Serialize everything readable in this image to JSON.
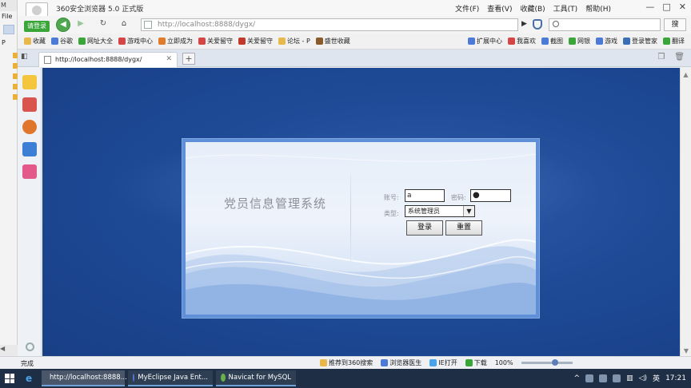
{
  "left_app": {
    "top_label": "M",
    "file_label": "File",
    "tab_label": "P"
  },
  "browser": {
    "title": "360安全浏览器 5.0 正式版",
    "login_badge": "请登录",
    "menu": [
      "文件(F)",
      "查看(V)",
      "收藏(B)",
      "工具(T)",
      "帮助(H)"
    ],
    "window_controls": [
      "—",
      "□",
      "✕"
    ]
  },
  "navbar": {
    "address": "http://localhost:8888/dygx/",
    "search_placeholder": "",
    "search_button": "搜"
  },
  "bookmarks": {
    "left": [
      {
        "label": "收藏",
        "color": "#e8b94a"
      },
      {
        "label": "谷歌",
        "color": "#4b7bd6"
      },
      {
        "label": "网址大全",
        "color": "#3aa63a"
      },
      {
        "label": "游戏中心",
        "color": "#d64545"
      },
      {
        "label": "立即成为",
        "color": "#e07b2a"
      },
      {
        "label": "关爱留守",
        "color": "#d64545"
      },
      {
        "label": "关爱留守",
        "color": "#c0392b"
      },
      {
        "label": "论坛 - P",
        "color": "#e8b94a"
      },
      {
        "label": "盛世收藏",
        "color": "#8b5a2b"
      }
    ],
    "right": [
      {
        "label": "扩展中心",
        "color": "#4b7bd6"
      },
      {
        "label": "我喜欢",
        "color": "#d64545"
      },
      {
        "label": "截图",
        "color": "#4b7bd6"
      },
      {
        "label": "网银",
        "color": "#3aa63a"
      },
      {
        "label": "游戏",
        "color": "#4b7bd6"
      },
      {
        "label": "登录管家",
        "color": "#3a6fb5"
      },
      {
        "label": "翻译",
        "color": "#3aa63a"
      }
    ]
  },
  "tab": {
    "title": "http://localhost:8888/dygx/",
    "close": "✕",
    "new": "+"
  },
  "login": {
    "system_title": "党员信息管理系统",
    "account_label": "账号:",
    "account_value": "a",
    "password_label": "密码:",
    "password_mask": "●",
    "type_label": "类型:",
    "type_selected": "系统管理员",
    "login_button": "登录",
    "reset_button": "重置"
  },
  "statusbar": {
    "status": "完成",
    "items": [
      {
        "label": "推荐到360搜索",
        "color": "#e8b94a"
      },
      {
        "label": "浏览器医生",
        "color": "#4b7bd6"
      },
      {
        "label": "IE打开",
        "color": "#4aa3ea"
      },
      {
        "label": "下载",
        "color": "#3aa63a"
      }
    ],
    "zoom": "100%"
  },
  "taskbar": {
    "tasks": [
      {
        "label": "http://localhost:8888...",
        "color": "#3aa63a"
      },
      {
        "label": "MyEclipse Java Ent...",
        "color": "#5a6fd6"
      },
      {
        "label": "Navicat for MySQL",
        "color": "#6ab04c"
      }
    ],
    "ime": "英",
    "time": "17:21"
  }
}
